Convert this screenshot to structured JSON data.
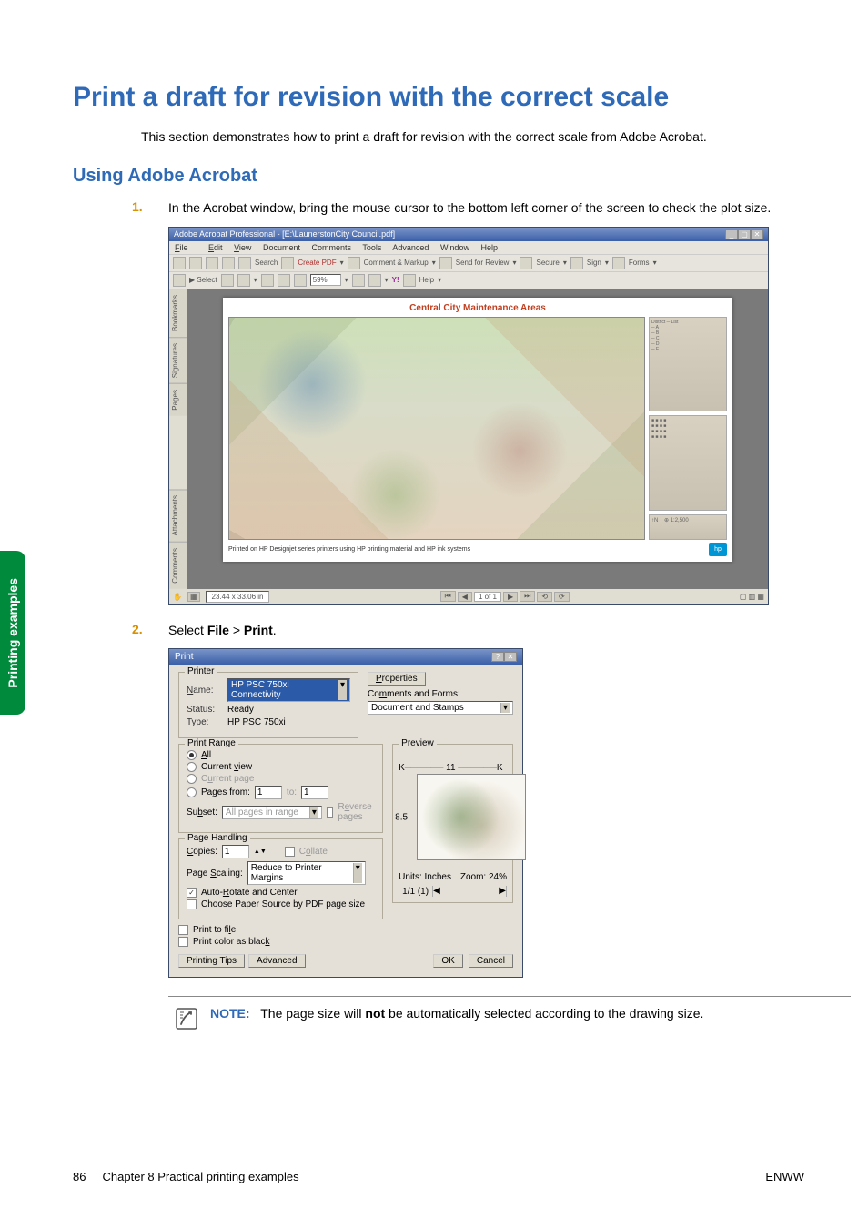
{
  "page": {
    "h1": "Print a draft for revision with the correct scale",
    "intro": "This section demonstrates how to print a draft for revision with the correct scale from Adobe Acrobat.",
    "h2": "Using Adobe Acrobat"
  },
  "steps": {
    "s1_num": "1.",
    "s1_text": "In the Acrobat window, bring the mouse cursor to the bottom left corner of the screen to check the plot size.",
    "s2_num": "2.",
    "s2_text_a": "Select ",
    "s2_file": "File",
    "s2_gt": " > ",
    "s2_print": "Print",
    "s2_period": "."
  },
  "acro": {
    "title": "Adobe Acrobat Professional - [E:\\LaunerstonCity Council.pdf]",
    "menu": {
      "file": "File",
      "edit": "Edit",
      "view": "View",
      "document": "Document",
      "comments": "Comments",
      "tools": "Tools",
      "advanced": "Advanced",
      "window": "Window",
      "help": "Help"
    },
    "tb": {
      "search": "Search",
      "createpdf": "Create PDF",
      "comment": "Comment & Markup",
      "send": "Send for Review",
      "secure": "Secure",
      "sign": "Sign",
      "forms": "Forms",
      "select": "Select",
      "zoom": "59%",
      "yahoo": "Y!",
      "help": "Help"
    },
    "tabs": {
      "bookmarks": "Bookmarks",
      "signatures": "Signatures",
      "pages": "Pages",
      "attachments": "Attachments",
      "comments": "Comments"
    },
    "plot_title": "Central City Maintenance Areas",
    "plot_footer": "Printed on HP Designjet series printers using HP printing material and HP ink systems",
    "hp": "hp",
    "scale": "1:2,500",
    "dims": "23.44 x 33.06 in",
    "page_nav": "1 of 1"
  },
  "dlg": {
    "title": "Print",
    "grp_printer": "Printer",
    "name": "Name:",
    "name_val": "HP PSC 750xi Connectivity",
    "status": "Status:",
    "status_val": "Ready",
    "type": "Type:",
    "type_val": "HP PSC 750xi",
    "properties": "Properties",
    "comments_forms": "Comments and Forms:",
    "cf_val": "Document and Stamps",
    "grp_range": "Print Range",
    "all": "All",
    "current_view": "Current view",
    "current_page": "Current page",
    "pages_from": "Pages from:",
    "pages_from_v": "1",
    "to": "to:",
    "to_v": "1",
    "subset": "Subset:",
    "subset_v": "All pages in range",
    "reverse": "Reverse pages",
    "grp_handling": "Page Handling",
    "copies": "Copies:",
    "copies_v": "1",
    "collate": "Collate",
    "page_scaling": "Page Scaling:",
    "scaling_v": "Reduce to Printer Margins",
    "autorot": "Auto-Rotate and Center",
    "paper_source": "Choose Paper Source by PDF page size",
    "print_to_file": "Print to file",
    "print_black": "Print color as black",
    "preview": "Preview",
    "pv_w": "11",
    "pv_h": "8.5",
    "units": "Units: Inches",
    "zoom": "Zoom:  24%",
    "nav": "1/1 (1)",
    "tips": "Printing Tips",
    "advanced": "Advanced",
    "ok": "OK",
    "cancel": "Cancel"
  },
  "note": {
    "label": "NOTE:",
    "text_a": "The page size will ",
    "text_b": "not",
    "text_c": " be automatically selected according to the drawing size."
  },
  "side_tab": "Printing examples",
  "footer": {
    "left_a": "86",
    "left_b": "Chapter 8   Practical printing examples",
    "right": "ENWW"
  }
}
